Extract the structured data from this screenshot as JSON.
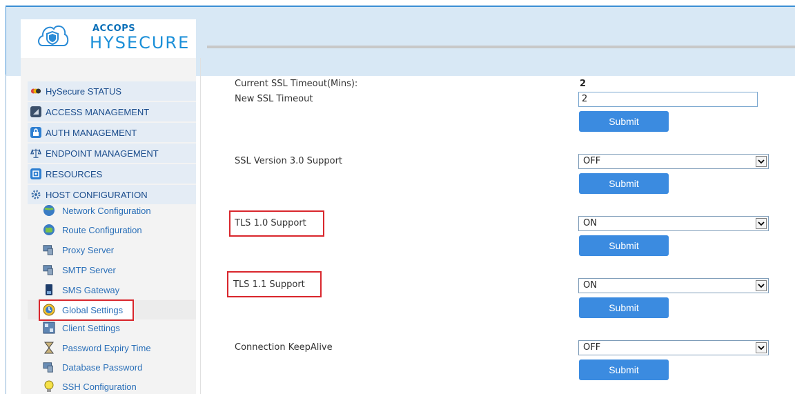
{
  "brand": {
    "company": "ACCOPS",
    "product": "HYSECURE"
  },
  "sidebar": {
    "menus": [
      {
        "label": "HySecure STATUS",
        "icon": "status-icon"
      },
      {
        "label": "ACCESS MANAGEMENT",
        "icon": "access-icon"
      },
      {
        "label": "AUTH MANAGEMENT",
        "icon": "lock-icon"
      },
      {
        "label": "ENDPOINT MANAGEMENT",
        "icon": "scale-icon"
      },
      {
        "label": "RESOURCES",
        "icon": "resources-icon"
      },
      {
        "label": "HOST CONFIGURATION",
        "icon": "gear-icon"
      }
    ],
    "sub_items": [
      {
        "label": "Network Configuration",
        "icon": "network-globe-icon"
      },
      {
        "label": "Route Configuration",
        "icon": "route-globe-icon"
      },
      {
        "label": "Proxy Server",
        "icon": "proxy-server-icon"
      },
      {
        "label": "SMTP Server",
        "icon": "smtp-server-icon"
      },
      {
        "label": "SMS Gateway",
        "icon": "phone-icon"
      },
      {
        "label": "Global Settings",
        "icon": "clock-settings-icon",
        "active": true
      },
      {
        "label": "Client Settings",
        "icon": "client-settings-icon"
      },
      {
        "label": "Password Expiry Time",
        "icon": "hourglass-icon"
      },
      {
        "label": "Database Password",
        "icon": "database-icon"
      },
      {
        "label": "SSH Configuration",
        "icon": "bulb-icon"
      }
    ]
  },
  "settings": {
    "ssl_timeout": {
      "current_label": "Current SSL Timeout(Mins):",
      "current_value": "2",
      "new_label": "New SSL Timeout",
      "new_value": "2",
      "submit": "Submit"
    },
    "ssl3": {
      "label": "SSL Version 3.0 Support",
      "value": "OFF",
      "submit": "Submit"
    },
    "tls10": {
      "label": "TLS 1.0 Support",
      "value": "ON",
      "submit": "Submit"
    },
    "tls11": {
      "label": "TLS 1.1 Support",
      "value": "ON",
      "submit": "Submit"
    },
    "keepalive": {
      "label": "Connection KeepAlive",
      "value": "OFF",
      "submit": "Submit"
    }
  },
  "colors": {
    "accent": "#3b8be0",
    "highlight": "#d9262c",
    "header_bg": "#d8e8f5",
    "menu_text": "#1a4c8c"
  }
}
